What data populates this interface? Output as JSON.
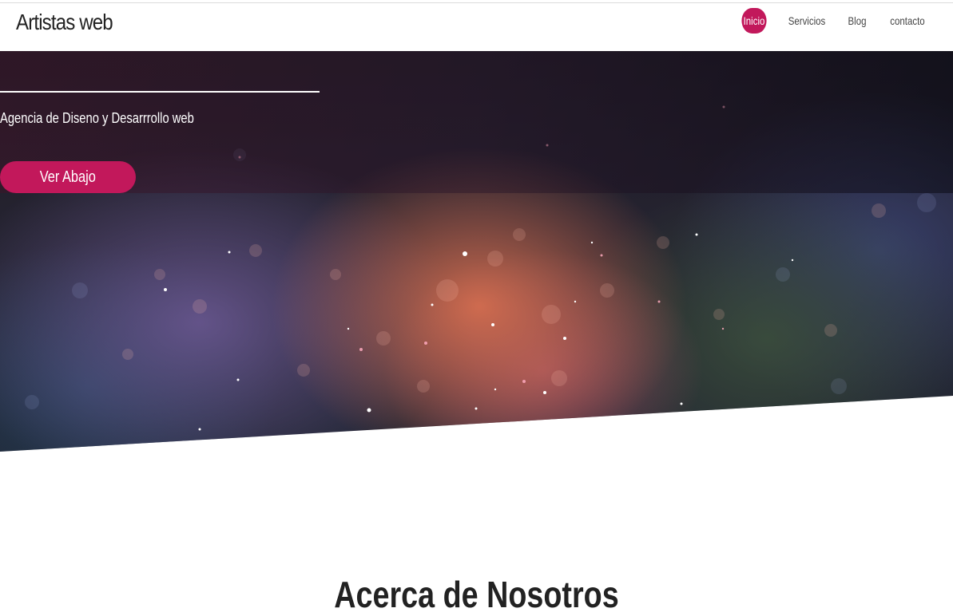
{
  "header": {
    "brand": "Artistas web",
    "nav": [
      {
        "label": "Inicio",
        "active": true
      },
      {
        "label": "Servicios",
        "active": false
      },
      {
        "label": "Blog",
        "active": false
      },
      {
        "label": "contacto",
        "active": false
      }
    ]
  },
  "hero": {
    "tagline": "Agencia de Diseno y Desarrrollo web",
    "cta_label": "Ver Abajo"
  },
  "section": {
    "title": "Acerca de Nosotros"
  },
  "colors": {
    "accent": "#c2185b",
    "text": "#222222"
  }
}
